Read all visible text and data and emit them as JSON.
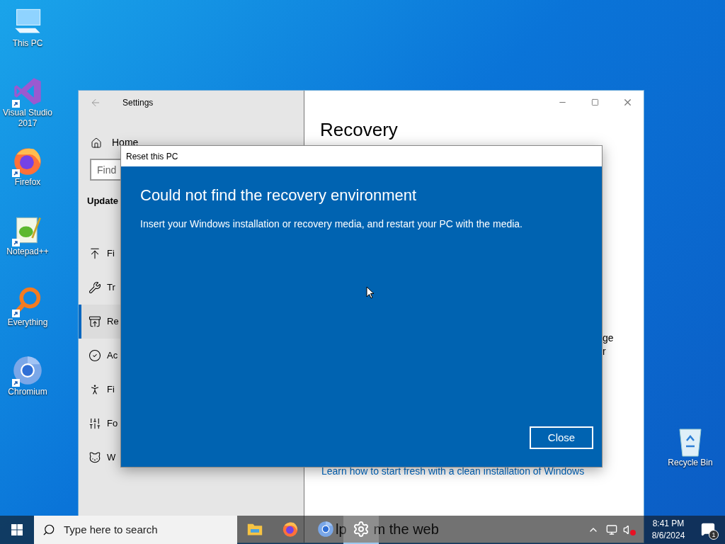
{
  "desktop_icons": [
    {
      "label": "This PC",
      "kind": "pc",
      "shortcut": false
    },
    {
      "label": "Visual Studio 2017",
      "kind": "vs",
      "shortcut": true
    },
    {
      "label": "Firefox",
      "kind": "firefox",
      "shortcut": true
    },
    {
      "label": "Notepad++",
      "kind": "notepad",
      "shortcut": true
    },
    {
      "label": "Everything",
      "kind": "everything",
      "shortcut": true
    },
    {
      "label": "Chromium",
      "kind": "chromium",
      "shortcut": true
    }
  ],
  "recycle_bin": {
    "label": "Recycle Bin"
  },
  "settings": {
    "title": "Settings",
    "home": "Home",
    "search_placeholder": "Find",
    "section": "Update",
    "nav": [
      {
        "label": "Fi",
        "kind": "upload",
        "selected": false
      },
      {
        "label": "Tr",
        "kind": "wrench",
        "selected": false
      },
      {
        "label": "Re",
        "kind": "recovery",
        "selected": true
      },
      {
        "label": "Ac",
        "kind": "check",
        "selected": false
      },
      {
        "label": "Fi",
        "kind": "person",
        "selected": false
      },
      {
        "label": "Fo",
        "kind": "tools",
        "selected": false
      },
      {
        "label": "W",
        "kind": "cat",
        "selected": false
      }
    ],
    "page_title": "Recovery",
    "fragments": [
      "ge",
      "r"
    ],
    "link": "Learn how to start fresh with a clean installation of Windows",
    "help_heading": [
      "lp",
      "m the web"
    ]
  },
  "dialog": {
    "title": "Reset this PC",
    "heading": "Could not find the recovery environment",
    "message": "Insert your Windows installation or recovery media, and restart your PC with the media.",
    "button": "Close"
  },
  "taskbar": {
    "search_placeholder": "Type here to search",
    "apps": [
      {
        "kind": "explorer",
        "active": false
      },
      {
        "kind": "firefox",
        "active": false
      },
      {
        "kind": "chromium",
        "active": false
      },
      {
        "kind": "settings",
        "active": true
      }
    ],
    "muted": true,
    "time": "8:41 PM",
    "date": "8/6/2024",
    "notifications": "1"
  }
}
